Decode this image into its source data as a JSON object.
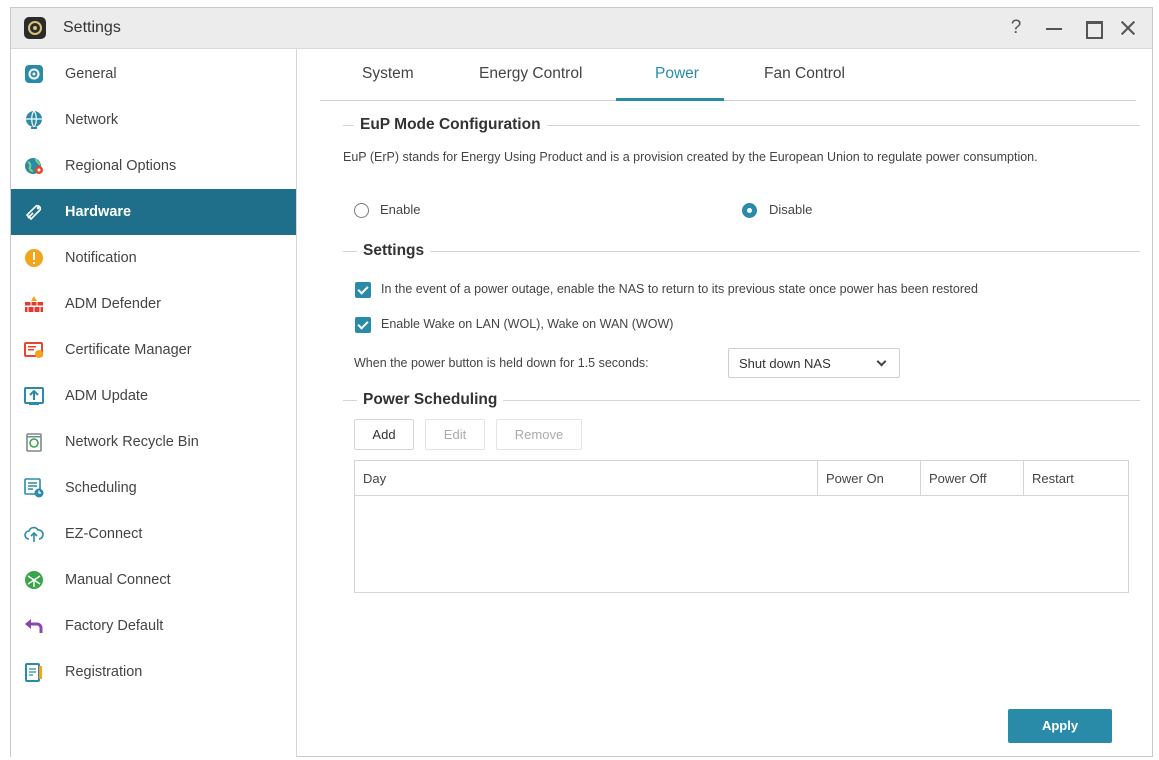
{
  "window": {
    "title": "Settings",
    "help_glyph": "?"
  },
  "sidebar": {
    "items": [
      {
        "label": "General",
        "icon": "general-icon",
        "color": "#2a8ba8"
      },
      {
        "label": "Network",
        "icon": "globe-icon",
        "color": "#2a8ba8"
      },
      {
        "label": "Regional Options",
        "icon": "regional-globe-icon",
        "color": "#2a8ba8"
      },
      {
        "label": "Hardware",
        "icon": "hardware-icon",
        "color": "#ffffff",
        "active": true
      },
      {
        "label": "Notification",
        "icon": "notification-icon",
        "color": "#f2a51a"
      },
      {
        "label": "ADM Defender",
        "icon": "defender-wall-icon",
        "color": "#e23b2e"
      },
      {
        "label": "Certificate Manager",
        "icon": "certificate-icon",
        "color": "#e8452c"
      },
      {
        "label": "ADM Update",
        "icon": "update-icon",
        "color": "#2a8ba8"
      },
      {
        "label": "Network Recycle Bin",
        "icon": "recycle-bin-icon",
        "color": "#7a8a8e"
      },
      {
        "label": "Scheduling",
        "icon": "scheduling-icon",
        "color": "#2a8ba8"
      },
      {
        "label": "EZ-Connect",
        "icon": "cloud-upload-icon",
        "color": "#2a8ba8"
      },
      {
        "label": "Manual Connect",
        "icon": "manual-connect-icon",
        "color": "#3aa54a"
      },
      {
        "label": "Factory Default",
        "icon": "undo-arrow-icon",
        "color": "#8e44ad"
      },
      {
        "label": "Registration",
        "icon": "registration-icon",
        "color": "#2a8ba8"
      }
    ]
  },
  "tabs": [
    {
      "label": "System"
    },
    {
      "label": "Energy Control"
    },
    {
      "label": "Power",
      "active": true
    },
    {
      "label": "Fan Control"
    }
  ],
  "eup": {
    "title": "EuP Mode Configuration",
    "description": "EuP (ErP) stands for Energy Using Product and is a provision created by the European Union to regulate power consumption.",
    "enable_label": "Enable",
    "disable_label": "Disable",
    "selected": "Disable"
  },
  "settings": {
    "title": "Settings",
    "power_restore_label": "In the event of a power outage, enable the NAS to return to its previous state once power has been restored",
    "power_restore_checked": true,
    "wol_label": "Enable Wake on LAN (WOL), Wake on WAN (WOW)",
    "wol_checked": true,
    "power_button_label": "When the power button is held down for 1.5 seconds:",
    "power_button_value": "Shut down NAS"
  },
  "scheduling": {
    "title": "Power Scheduling",
    "add_label": "Add",
    "edit_label": "Edit",
    "remove_label": "Remove",
    "columns": [
      "Day",
      "Power On",
      "Power Off",
      "Restart"
    ],
    "rows": []
  },
  "footer": {
    "apply_label": "Apply"
  },
  "colors": {
    "accent": "#2a8ba8",
    "sidebar_active": "#1f6f8b"
  }
}
